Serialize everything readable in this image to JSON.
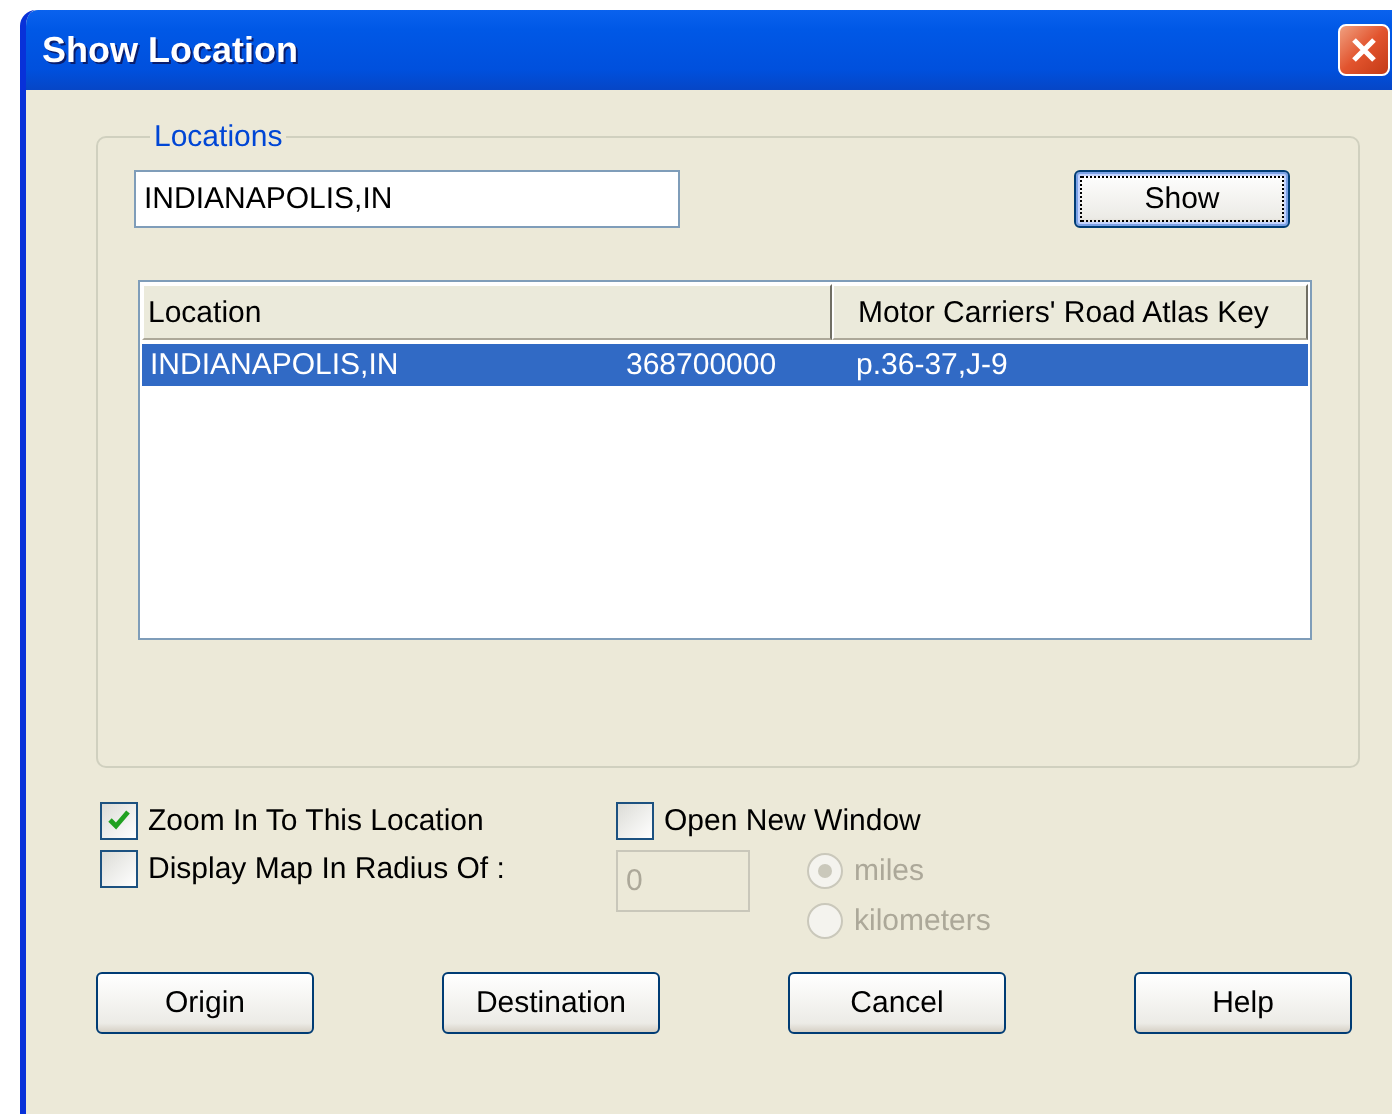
{
  "window": {
    "title": "Show Location"
  },
  "locations": {
    "legend": "Locations",
    "search_value": "INDIANAPOLIS,IN",
    "show_button": {
      "label": "Show",
      "default": true
    },
    "list": {
      "columns": [
        "Location",
        "",
        "Motor Carriers' Road Atlas Key"
      ],
      "rows": [
        {
          "cells": [
            "INDIANAPOLIS,IN",
            "368700000",
            "p.36-37,J-9"
          ],
          "selected": true
        }
      ]
    }
  },
  "options": [
    {
      "label": "Zoom In To This Location",
      "checked": true
    },
    {
      "label": "Open New Window",
      "checked": false
    },
    {
      "label": "Display Map In Radius Of :",
      "checked": false
    }
  ],
  "radius": {
    "value": "0",
    "disabled": true
  },
  "units": [
    {
      "label": "miles",
      "selected": true,
      "disabled": true
    },
    {
      "label": "kilometers",
      "selected": false,
      "disabled": true
    }
  ],
  "buttons": [
    {
      "label": "Origin",
      "default": false
    },
    {
      "label": "Destination",
      "default": false
    },
    {
      "label": "Cancel",
      "default": false
    },
    {
      "label": "Help",
      "default": false
    }
  ]
}
